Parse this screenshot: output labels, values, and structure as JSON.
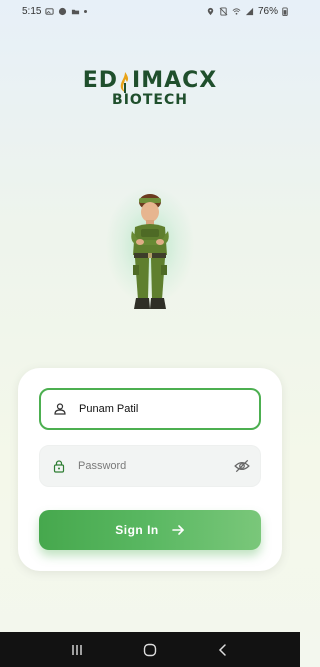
{
  "status_bar": {
    "time": "5:15",
    "battery": "76%"
  },
  "logo": {
    "brand_prefix": "ED",
    "brand_suffix": "IMACX",
    "brand_sub": "BIOTECH"
  },
  "login": {
    "username_value": "Punam Patil",
    "password_placeholder": "Password",
    "signin_label": "Sign In"
  },
  "colors": {
    "accent": "#4caf50",
    "brand_dark": "#1f4f2c",
    "flame": "#e8a317"
  },
  "icons": {
    "username": "person-icon",
    "password": "lock-icon",
    "visibility": "eye-off-icon",
    "signin": "arrow-right-icon"
  }
}
